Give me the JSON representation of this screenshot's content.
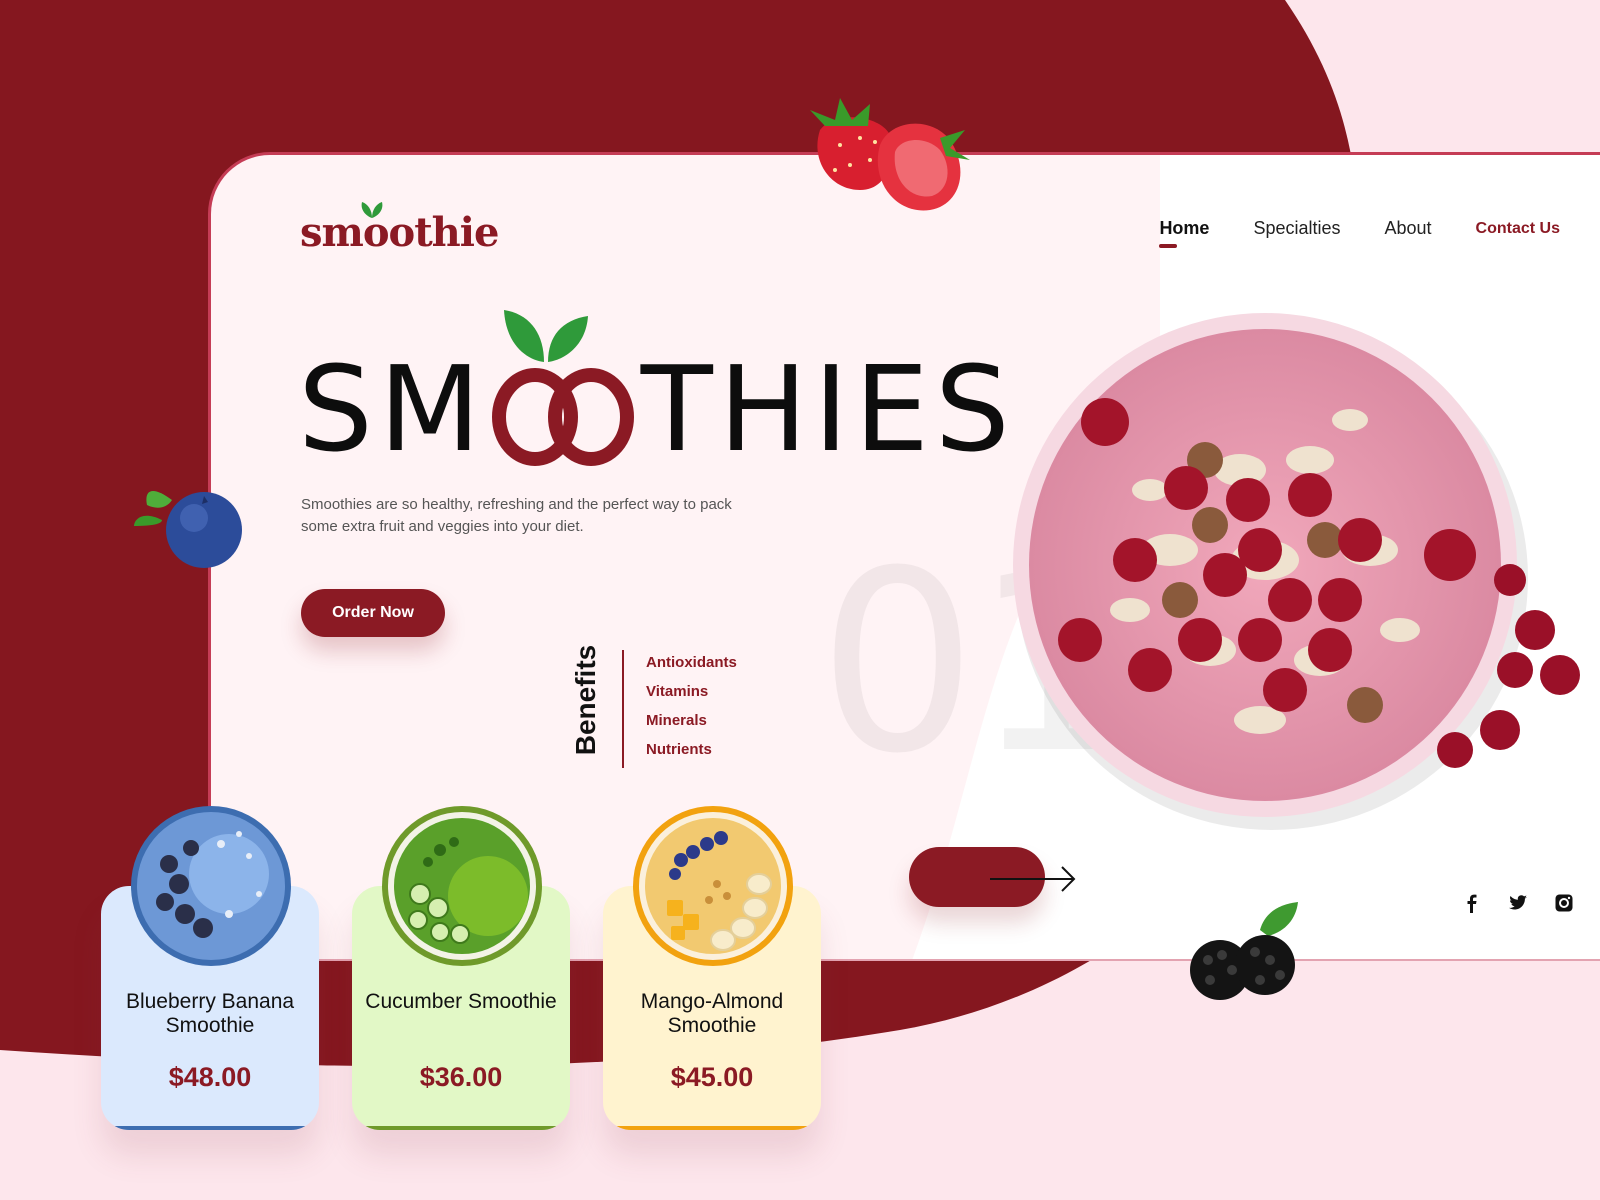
{
  "brand": {
    "logo_text": "smoothie"
  },
  "nav": {
    "items": [
      "Home",
      "Specialties",
      "About"
    ],
    "contact": "Contact Us"
  },
  "hero": {
    "title_left": "SM",
    "title_right": "THIES",
    "subtitle": "Smoothies are so healthy, refreshing and the perfect way to pack some extra fruit and veggies into your diet.",
    "cta": "Order Now",
    "slide_number": "01"
  },
  "benefits": {
    "label": "Benefits",
    "items": [
      "Antioxidants",
      "Vitamins",
      "Minerals",
      "Nutrients"
    ]
  },
  "products": [
    {
      "name": "Blueberry Banana Smoothie",
      "price": "$48.00",
      "bg": "#dbe9fd",
      "accent": "#3d6db0"
    },
    {
      "name": "Cucumber Smoothie",
      "price": "$36.00",
      "bg": "#e2f8c6",
      "accent": "#6f9a2a"
    },
    {
      "name": "Mango-Almond Smoothie",
      "price": "$45.00",
      "bg": "#fff3cf",
      "accent": "#f2a20f"
    }
  ],
  "social": [
    "facebook-icon",
    "twitter-icon",
    "instagram-icon"
  ],
  "colors": {
    "brand": "#8b1a24",
    "background_dark": "#85171f",
    "background_light": "#fde6ec",
    "card": "#fff3f5"
  }
}
